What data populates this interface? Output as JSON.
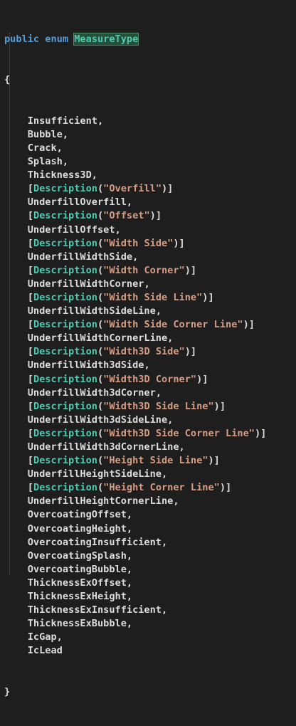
{
  "header": {
    "keyword_public": "public",
    "keyword_enum": "enum",
    "type_name": "MeasureType"
  },
  "open_brace": "{",
  "close_brace": "}",
  "attribute_name": "Description",
  "members": [
    {
      "attr": null,
      "name": "Insufficient",
      "comma": ","
    },
    {
      "attr": null,
      "name": "Bubble",
      "comma": ","
    },
    {
      "attr": null,
      "name": "Crack",
      "comma": ","
    },
    {
      "attr": null,
      "name": "Splash",
      "comma": ","
    },
    {
      "attr": null,
      "name": "Thickness3D",
      "comma": ","
    },
    {
      "attr": "\"Overfill\"",
      "name": "UnderfillOverfill",
      "comma": ","
    },
    {
      "attr": "\"Offset\"",
      "name": "UnderfillOffset",
      "comma": ","
    },
    {
      "attr": "\"Width Side\"",
      "name": "UnderfillWidthSide",
      "comma": ","
    },
    {
      "attr": "\"Width Corner\"",
      "name": "UnderfillWidthCorner",
      "comma": ","
    },
    {
      "attr": "\"Width Side Line\"",
      "name": "UnderfillWidthSideLine",
      "comma": ","
    },
    {
      "attr": "\"Width Side Corner Line\"",
      "name": "UnderfillWidthCornerLine",
      "comma": ","
    },
    {
      "attr": "\"Width3D Side\"",
      "name": "UnderfillWidth3dSide",
      "comma": ","
    },
    {
      "attr": "\"Width3D Corner\"",
      "name": "UnderfillWidth3dCorner",
      "comma": ","
    },
    {
      "attr": "\"Width3D Side Line\"",
      "name": "UnderfillWidth3dSideLine",
      "comma": ","
    },
    {
      "attr": "\"Width3D Side Corner Line\"",
      "name": "UnderfillWidth3dCornerLine",
      "comma": ","
    },
    {
      "attr": "\"Height Side Line\"",
      "name": "UnderfillHeightSideLine",
      "comma": ","
    },
    {
      "attr": "\"Height Corner Line\"",
      "name": "UnderfillHeightCornerLine",
      "comma": ","
    },
    {
      "attr": null,
      "name": "OvercoatingOffset",
      "comma": ","
    },
    {
      "attr": null,
      "name": "OvercoatingHeight",
      "comma": ","
    },
    {
      "attr": null,
      "name": "OvercoatingInsufficient",
      "comma": ","
    },
    {
      "attr": null,
      "name": "OvercoatingSplash",
      "comma": ","
    },
    {
      "attr": null,
      "name": "OvercoatingBubble",
      "comma": ","
    },
    {
      "attr": null,
      "name": "ThicknessExOffset",
      "comma": ","
    },
    {
      "attr": null,
      "name": "ThicknessExHeight",
      "comma": ","
    },
    {
      "attr": null,
      "name": "ThicknessExInsufficient",
      "comma": ","
    },
    {
      "attr": null,
      "name": "ThicknessExBubble",
      "comma": ","
    },
    {
      "attr": null,
      "name": "IcGap",
      "comma": ","
    },
    {
      "attr": null,
      "name": "IcLead",
      "comma": ""
    }
  ],
  "colors": {
    "background": "#1e1e1e",
    "keyword": "#569cd6",
    "type": "#4ec9b0",
    "string": "#d69d85",
    "text": "#dcdcdc"
  }
}
